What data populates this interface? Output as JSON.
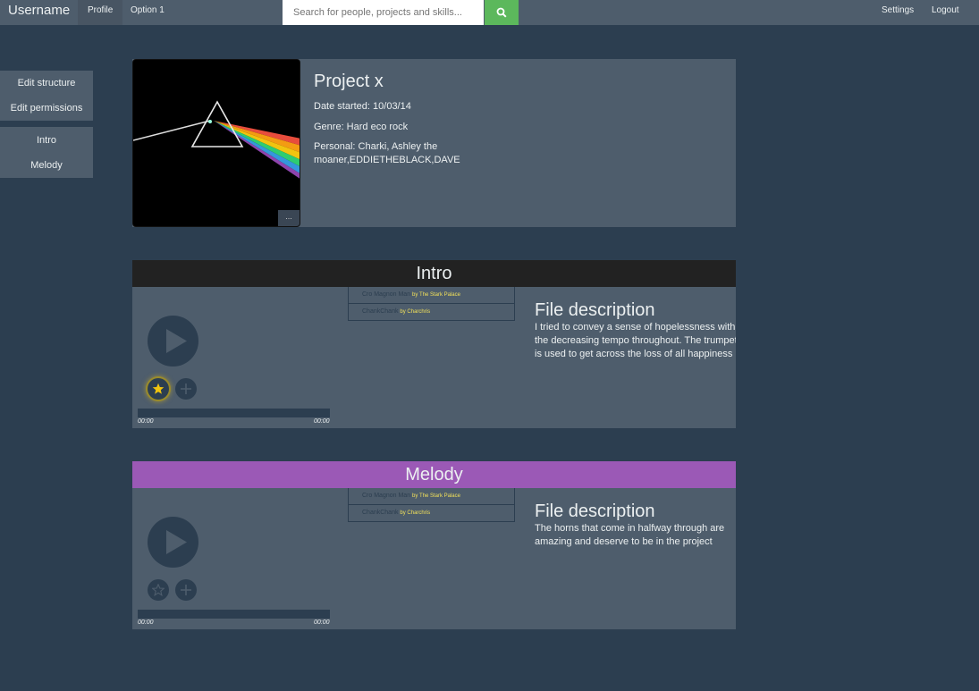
{
  "nav": {
    "brand": "Username",
    "profile": "Profile",
    "option1": "Option 1",
    "search_placeholder": "Search for people, projects and skills...",
    "settings": "Settings",
    "logout": "Logout"
  },
  "sidebar": {
    "admin": [
      "Edit structure",
      "Edit permissions"
    ],
    "sections": [
      "Intro",
      "Melody"
    ]
  },
  "project": {
    "title": "Project x",
    "date": "Date started: 10/03/14",
    "genre": "Genre: Hard eco rock",
    "personal": "Personal: Charki, Ashley the moaner,EDDIETHEBLACK,DAVE",
    "more": "..."
  },
  "sections": [
    {
      "title": "Intro",
      "color": "#222222",
      "starred": true,
      "time_start": "00:00",
      "time_end": "00:00",
      "tracks": [
        {
          "name": "Cro Magnon Man",
          "by": "by The Stark Palace"
        },
        {
          "name": "ChankChank",
          "by": "by Charchris"
        }
      ],
      "desc_title": "File description",
      "desc_text": "I tried to convey a sense of hopelessness with the decreasing tempo throughout. The trumpet is used to get across the loss of all happiness"
    },
    {
      "title": "Melody",
      "color": "#9b59b6",
      "starred": false,
      "time_start": "00:00",
      "time_end": "00:00",
      "tracks": [
        {
          "name": "Cro Magnon Man",
          "by": "by The Stark Palace"
        },
        {
          "name": "ChankChank",
          "by": "by Charchris"
        }
      ],
      "desc_title": "File description",
      "desc_text": "The horns that come in halfway through are amazing and deserve to be in the project"
    }
  ]
}
